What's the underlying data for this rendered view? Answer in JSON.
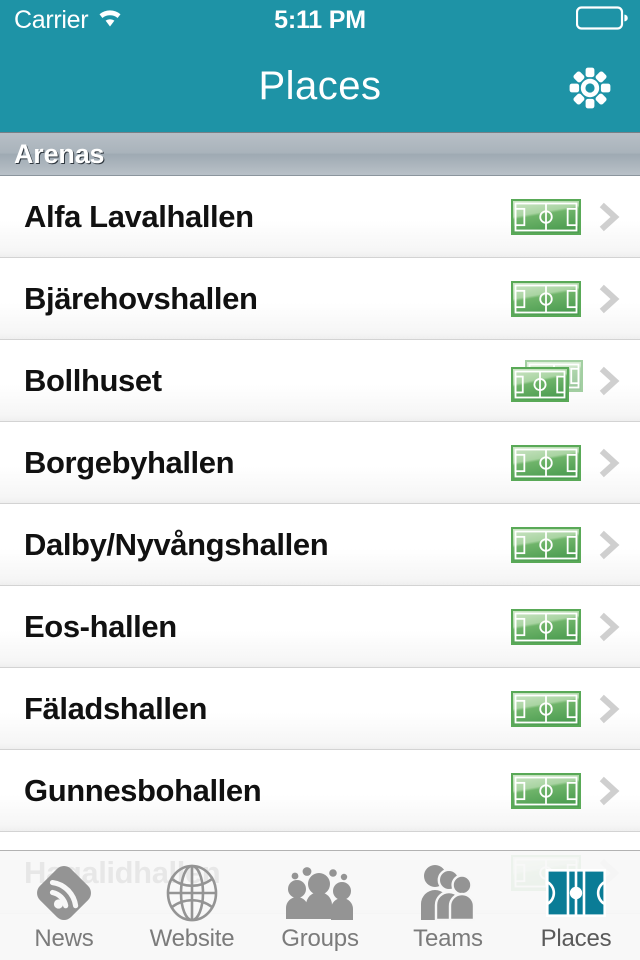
{
  "status_bar": {
    "carrier": "Carrier",
    "wifi_icon": "wifi-icon",
    "time": "5:11 PM",
    "battery_icon": "battery-icon"
  },
  "nav_bar": {
    "title": "Places",
    "settings_icon": "gear-icon",
    "background_color": "#1e93a6"
  },
  "section": {
    "header": "Arenas"
  },
  "rows": [
    {
      "title": "Alfa Lavalhallen",
      "icon": "soccer-field-icon",
      "stacked": false,
      "accessory": "chevron-right-icon"
    },
    {
      "title": "Bjärehovshallen",
      "icon": "soccer-field-icon",
      "stacked": false,
      "accessory": "chevron-right-icon"
    },
    {
      "title": "Bollhuset",
      "icon": "soccer-field-stacked-icon",
      "stacked": true,
      "accessory": "chevron-right-icon"
    },
    {
      "title": "Borgebyhallen",
      "icon": "soccer-field-icon",
      "stacked": false,
      "accessory": "chevron-right-icon"
    },
    {
      "title": "Dalby/Nyvångshallen",
      "icon": "soccer-field-icon",
      "stacked": false,
      "accessory": "chevron-right-icon"
    },
    {
      "title": "Eos-hallen",
      "icon": "soccer-field-icon",
      "stacked": false,
      "accessory": "chevron-right-icon"
    },
    {
      "title": "Fäladshallen",
      "icon": "soccer-field-icon",
      "stacked": false,
      "accessory": "chevron-right-icon"
    },
    {
      "title": "Gunnesbohallen",
      "icon": "soccer-field-icon",
      "stacked": false,
      "accessory": "chevron-right-icon"
    },
    {
      "title": "Hagalidhallen",
      "icon": "soccer-field-icon",
      "stacked": false,
      "accessory": "chevron-right-icon"
    }
  ],
  "tab_bar": {
    "items": [
      {
        "label": "News",
        "icon": "rss-diamond-icon",
        "active": false
      },
      {
        "label": "Website",
        "icon": "globe-icon",
        "active": false
      },
      {
        "label": "Groups",
        "icon": "groups-icon",
        "active": false
      },
      {
        "label": "Teams",
        "icon": "teams-icon",
        "active": false
      },
      {
        "label": "Places",
        "icon": "court-icon",
        "active": true
      }
    ],
    "active_color": "#0a7c96",
    "inactive_color": "#8e8e8e"
  },
  "colors": {
    "teal": "#1e93a6",
    "pitch_green": "#58a85a",
    "pitch_light": "#b9dcb5",
    "section_gray": "#a9b3bb"
  }
}
